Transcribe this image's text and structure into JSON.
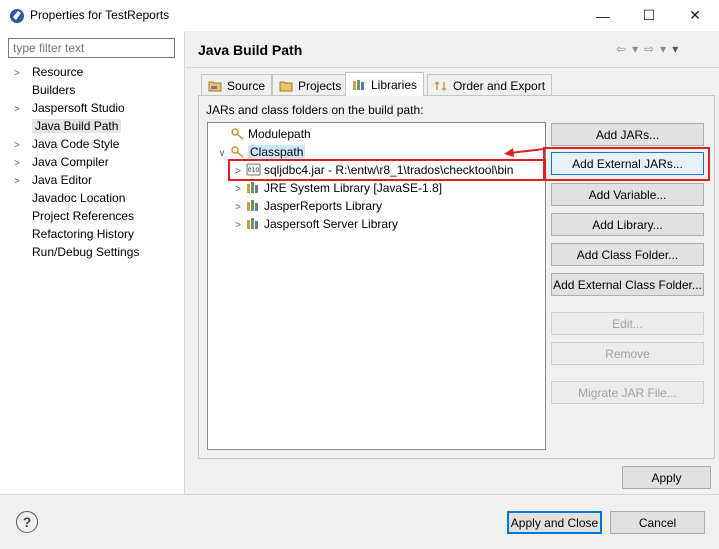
{
  "window": {
    "title": "Properties for TestReports",
    "minimize": "—",
    "maximize": "☐",
    "close": "✕"
  },
  "filter": {
    "placeholder": "type filter text"
  },
  "nav_tree": [
    {
      "label": "Resource",
      "expandable": true
    },
    {
      "label": "Builders",
      "expandable": false
    },
    {
      "label": "Jaspersoft Studio",
      "expandable": true
    },
    {
      "label": "Java Build Path",
      "expandable": false,
      "selected": true
    },
    {
      "label": "Java Code Style",
      "expandable": true
    },
    {
      "label": "Java Compiler",
      "expandable": true
    },
    {
      "label": "Java Editor",
      "expandable": true
    },
    {
      "label": "Javadoc Location",
      "expandable": false
    },
    {
      "label": "Project References",
      "expandable": false
    },
    {
      "label": "Refactoring History",
      "expandable": false
    },
    {
      "label": "Run/Debug Settings",
      "expandable": false
    }
  ],
  "page": {
    "title": "Java Build Path"
  },
  "tabs": [
    {
      "label": "Source",
      "icon": "source-folder-icon"
    },
    {
      "label": "Projects",
      "icon": "projects-icon"
    },
    {
      "label": "Libraries",
      "icon": "libraries-icon",
      "active": true
    },
    {
      "label": "Order and Export",
      "icon": "order-export-icon"
    }
  ],
  "panel_label": "JARs and class folders on the build path:",
  "build_tree": {
    "modulepath": "Modulepath",
    "classpath": "Classpath",
    "entries": [
      {
        "label": "sqljdbc4.jar - R:\\entw\\r8_1\\trados\\checktool\\bin",
        "icon": "jar-icon"
      },
      {
        "label": "JRE System Library [JavaSE-1.8]",
        "icon": "library-icon"
      },
      {
        "label": "JasperReports Library",
        "icon": "library-icon"
      },
      {
        "label": "Jaspersoft Server Library",
        "icon": "library-icon"
      }
    ]
  },
  "buttons": {
    "add_jars": "Add JARs...",
    "add_external_jars": "Add External JARs...",
    "add_variable": "Add Variable...",
    "add_library": "Add Library...",
    "add_class_folder": "Add Class Folder...",
    "add_external_class_folder": "Add External Class Folder...",
    "edit": "Edit...",
    "remove": "Remove",
    "migrate": "Migrate JAR File...",
    "apply": "Apply",
    "apply_and_close": "Apply and Close",
    "cancel": "Cancel",
    "help": "?"
  },
  "colors": {
    "highlight": "#e02020",
    "default_button_border": "#0078d7"
  }
}
